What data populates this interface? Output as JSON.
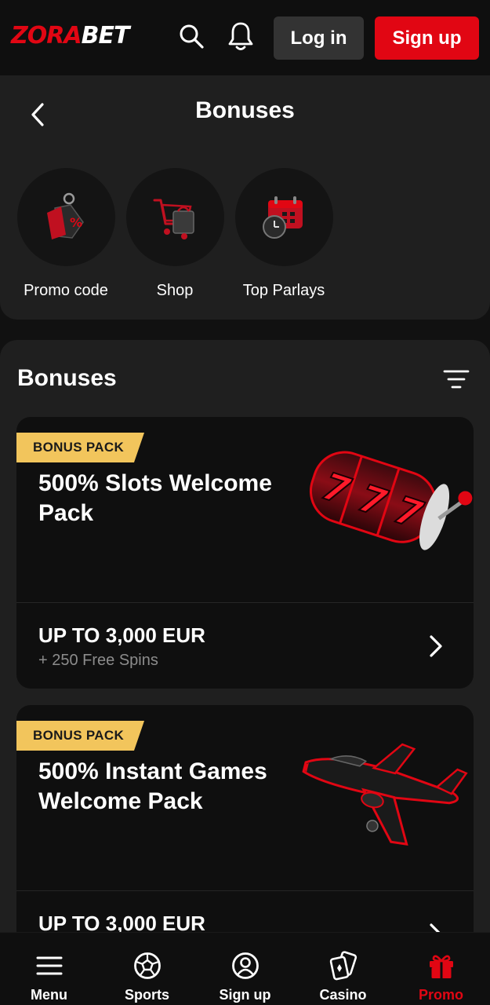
{
  "header": {
    "logo_part1": "ZORA",
    "logo_part2": "BET",
    "search_icon": "search-icon",
    "bell_icon": "bell-icon",
    "login_label": "Log in",
    "signup_label": "Sign up"
  },
  "top": {
    "title": "Bonuses",
    "back_icon": "chevron-left-icon",
    "categories": [
      {
        "label": "Promo code",
        "icon": "price-tag-icon"
      },
      {
        "label": "Shop",
        "icon": "shopping-cart-icon"
      },
      {
        "label": "Top Parlays",
        "icon": "calendar-clock-icon"
      }
    ]
  },
  "bonuses": {
    "title": "Bonuses",
    "filter_icon": "filter-icon",
    "cards": [
      {
        "badge": "BONUS PACK",
        "title": "500% Slots Welcome Pack",
        "amount": "UP TO 3,000 EUR",
        "extra": "+ 250 Free Spins",
        "art": "slot-machine-777-icon"
      },
      {
        "badge": "BONUS PACK",
        "title": "500% Instant Games Welcome Pack",
        "amount": "UP TO 3,000 EUR",
        "extra": "",
        "art": "airplane-icon"
      }
    ]
  },
  "nav": {
    "items": [
      {
        "label": "Menu",
        "icon": "hamburger-icon"
      },
      {
        "label": "Sports",
        "icon": "soccer-ball-icon"
      },
      {
        "label": "Sign up",
        "icon": "user-icon"
      },
      {
        "label": "Casino",
        "icon": "playing-cards-icon"
      },
      {
        "label": "Promo",
        "icon": "gift-icon",
        "active": true
      }
    ]
  },
  "colors": {
    "accent": "#e10613",
    "badge": "#f2c55c",
    "background": "#111111",
    "panel": "#1f1f1f",
    "card": "#0f0f0f"
  }
}
